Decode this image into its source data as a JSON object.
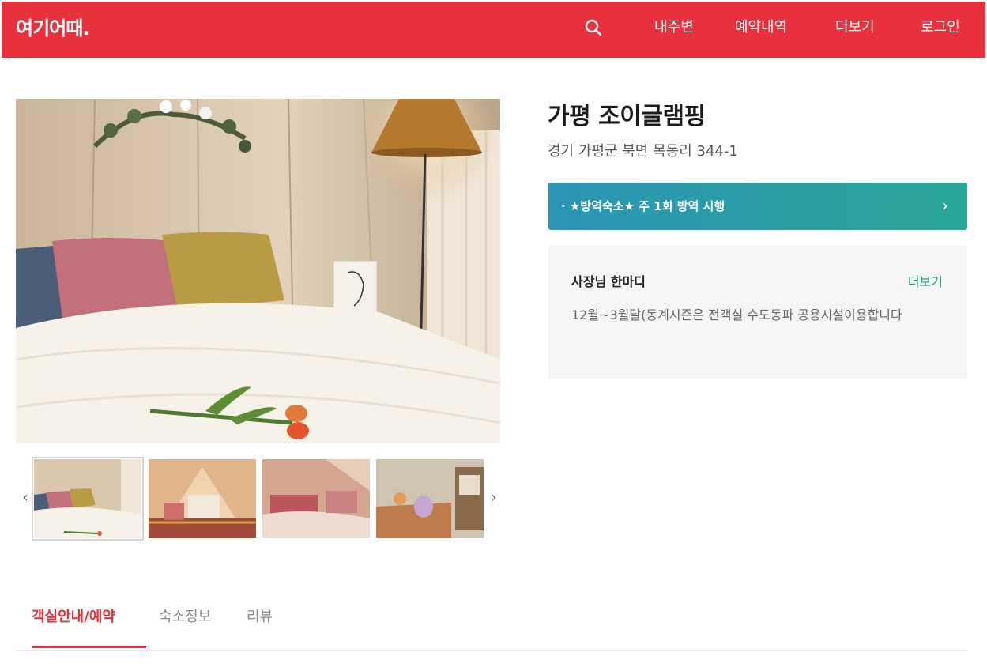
{
  "header": {
    "logo": "여기어때.",
    "nav": [
      {
        "label": "내주변"
      },
      {
        "label": "예약내역"
      },
      {
        "label": "더보기"
      },
      {
        "label": "로그인"
      }
    ]
  },
  "property": {
    "name": "가평 조이글램핑",
    "address": "경기 가평군 북면 목동리 344-1"
  },
  "notice": {
    "text": "· ★방역숙소★ 주 1회 방역 시행"
  },
  "owner": {
    "title": "사장님 한마디",
    "more": "더보기",
    "message": "12월~3월달(동계시즌은 전객실 수도동파 공용시설이용합니다"
  },
  "tabs": [
    {
      "label": "객실안내/예약",
      "active": true
    },
    {
      "label": "숙소정보",
      "active": false
    },
    {
      "label": "리뷰",
      "active": false
    }
  ],
  "colors": {
    "brand": "#e8313c",
    "notice_start": "#2b95b6",
    "notice_end": "#2aa697",
    "owner_more": "#1aa37a"
  },
  "icons": {
    "search": "search-icon",
    "prev": "chevron-left-icon",
    "next": "chevron-right-icon",
    "notice_arrow": "chevron-right-icon"
  }
}
